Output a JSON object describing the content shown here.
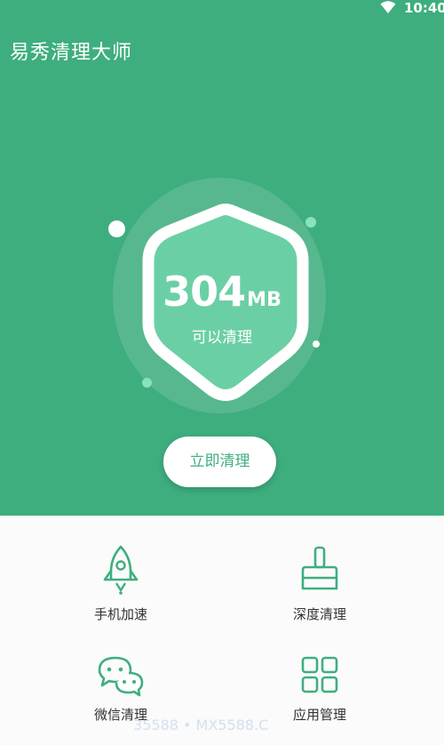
{
  "status_bar": {
    "time": "10:40",
    "wifi_icon": "wifi-icon"
  },
  "app": {
    "title": "易秀清理大师"
  },
  "storage": {
    "value": "304",
    "unit": "MB",
    "caption": "可以清理"
  },
  "actions": {
    "clean_now": "立即清理"
  },
  "tools": [
    {
      "label": "手机加速",
      "icon": "rocket-icon"
    },
    {
      "label": "深度清理",
      "icon": "brush-icon"
    },
    {
      "label": "微信清理",
      "icon": "wechat-icon"
    },
    {
      "label": "应用管理",
      "icon": "apps-grid-icon"
    }
  ],
  "watermark": "35588 • MX5588.C",
  "colors": {
    "accent": "#3fae7f",
    "shield_inner": "#6bcfa5",
    "highlight_dot": "#87e3bb"
  }
}
